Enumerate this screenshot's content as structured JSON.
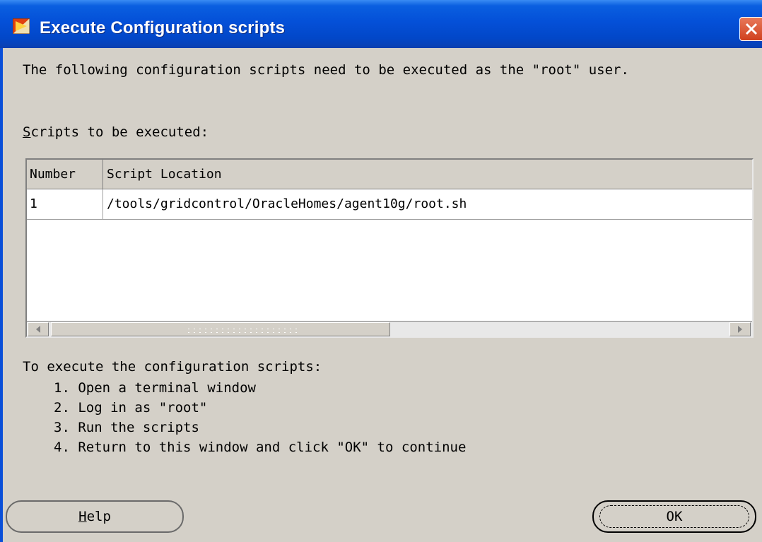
{
  "window": {
    "title": "Execute Configuration scripts",
    "close_icon": "close-icon",
    "app_icon": "installer-icon",
    "accent_color": "#0450d8"
  },
  "intro_text": "The following configuration scripts need to be executed as the \"root\" user.",
  "scripts_label": "Scripts to be executed:",
  "scripts_label_mnemonic": "S",
  "scripts_label_rest": "cripts to be executed:",
  "table": {
    "columns": [
      "Number",
      "Script Location"
    ],
    "rows": [
      {
        "number": "1",
        "location": "/tools/gridcontrol/OracleHomes/agent10g/root.sh"
      }
    ]
  },
  "instructions": {
    "heading": "To execute the configuration scripts:",
    "steps": [
      "1. Open a terminal window",
      "2. Log in as \"root\"",
      "3. Run the scripts",
      "4. Return to this window and click \"OK\" to continue"
    ]
  },
  "buttons": {
    "help_label": "Help",
    "help_mnemonic": "H",
    "help_rest": "elp",
    "ok_label": "OK"
  }
}
